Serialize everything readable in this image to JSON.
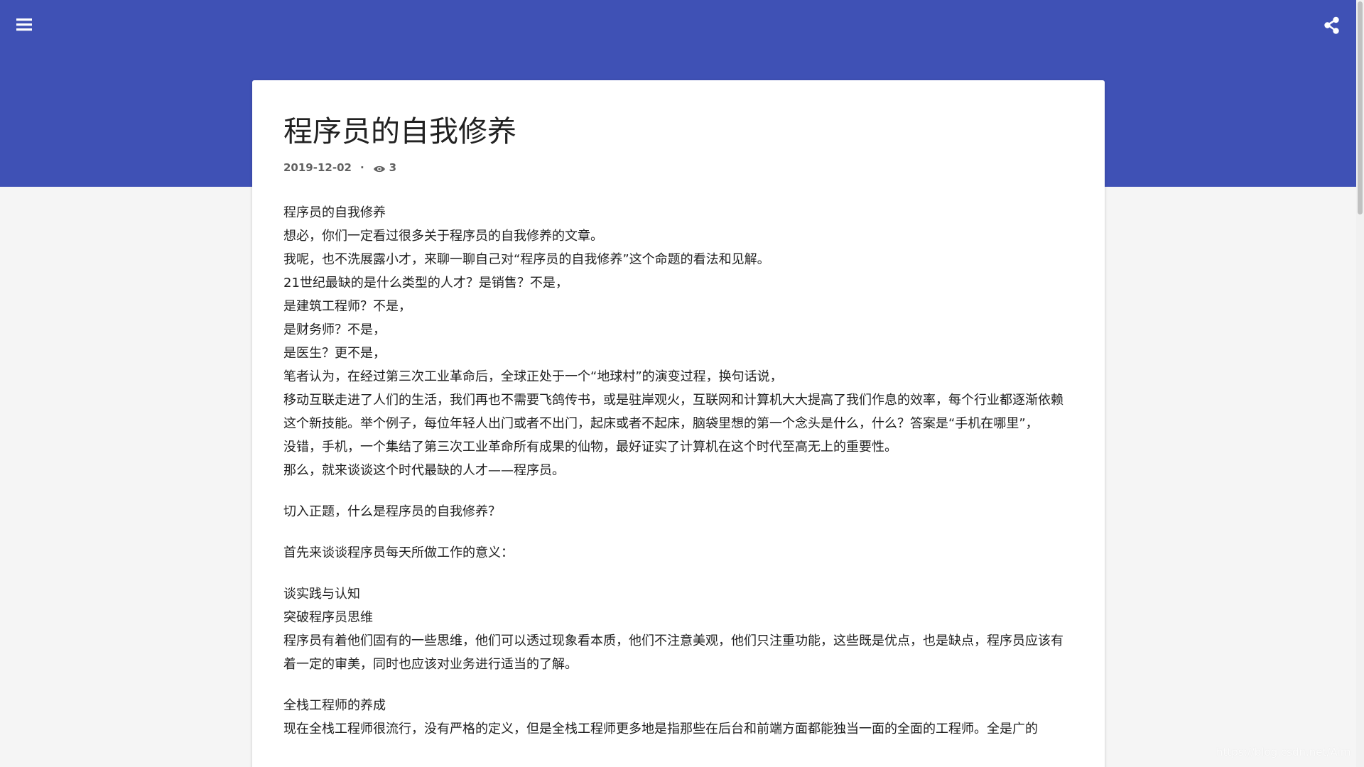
{
  "header": {
    "menu_icon": "menu-icon",
    "share_icon": "share-icon",
    "accent_color": "#3f51b5"
  },
  "article": {
    "title": "程序员的自我修养",
    "date": "2019-12-02",
    "separator": "·",
    "views": "3",
    "paragraphs": [
      [
        "程序员的自我修养",
        "想必，你们一定看过很多关于程序员的自我修养的文章。",
        "我呢，也不洗展露小才，来聊一聊自己对“程序员的自我修养”这个命题的看法和见解。",
        "21世纪最缺的是什么类型的人才？是销售？不是，",
        "是建筑工程师？不是，",
        "是财务师？不是，",
        "是医生？更不是，",
        "笔者认为，在经过第三次工业革命后，全球正处于一个“地球村”的演变过程，换句话说，",
        "移动互联走进了人们的生活，我们再也不需要飞鸽传书，或是驻岸观火，互联网和计算机大大提高了我们作息的效率，每个行业都逐渐依赖这个新技能。举个例子，每位年轻人出门或者不出门，起床或者不起床，脑袋里想的第一个念头是什么，什么？答案是“手机在哪里”，",
        "没错，手机，一个集结了第三次工业革命所有成果的仙物，最好证实了计算机在这个时代至高无上的重要性。",
        "那么，就来谈谈这个时代最缺的人才——程序员。"
      ],
      [
        "切入正题，什么是程序员的自我修养？"
      ],
      [
        "首先来谈谈程序员每天所做工作的意义："
      ],
      [
        "谈实践与认知",
        "突破程序员思维",
        "程序员有着他们固有的一些思维，他们可以透过现象看本质，他们不注意美观，他们只注重功能，这些既是优点，也是缺点，程序员应该有着一定的审美，同时也应该对业务进行适当的了解。"
      ],
      [
        "全栈工程师的养成",
        "现在全栈工程师很流行，没有严格的定义，但是全栈工程师更多地是指那些在后台和前端方面都能独当一面的全面的工程师。全是广的"
      ]
    ]
  },
  "watermark": "https://blog.csdn.net/Aimeto"
}
